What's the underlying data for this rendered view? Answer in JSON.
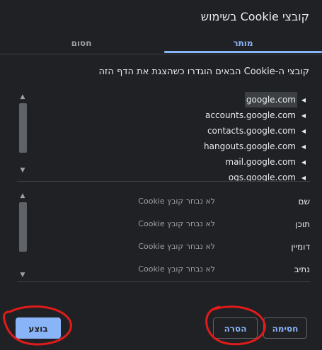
{
  "dialog": {
    "title": "קובצי Cookie בשימוש"
  },
  "tabs": [
    {
      "label": "מותר",
      "active": true
    },
    {
      "label": "חסום",
      "active": false
    }
  ],
  "subtitle": "קובצי ה-Cookie הבאים הוגדרו כשהצגת את הדף הזה",
  "cookie_tree": {
    "items": [
      {
        "label": "google.com",
        "selected": true
      },
      {
        "label": "accounts.google.com",
        "selected": false
      },
      {
        "label": "contacts.google.com",
        "selected": false
      },
      {
        "label": "hangouts.google.com",
        "selected": false
      },
      {
        "label": "mail.google.com",
        "selected": false
      },
      {
        "label": "ogs.google.com",
        "selected": false
      }
    ]
  },
  "details": {
    "rows": [
      {
        "key": "שם",
        "value": "לא נבחר קובץ Cookie"
      },
      {
        "key": "תוכן",
        "value": "לא נבחר קובץ Cookie"
      },
      {
        "key": "דומיין",
        "value": "לא נבחר קובץ Cookie"
      },
      {
        "key": "נתיב",
        "value": "לא נבחר קובץ Cookie"
      }
    ]
  },
  "buttons": {
    "block": "חסימה",
    "remove": "הסרה",
    "done": "בוצע"
  },
  "colors": {
    "background": "#202124",
    "accent": "#8ab4f8",
    "annotation": "#e01b1b"
  }
}
